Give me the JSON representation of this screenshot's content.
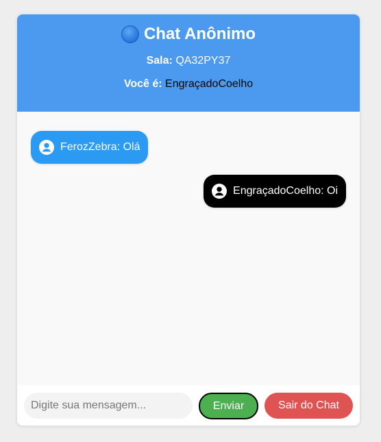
{
  "header": {
    "icon": "blue-circle-icon",
    "title": "Chat Anônimo",
    "room_label": "Sala:",
    "room_code": "QA32PY37",
    "you_label": "Você é:",
    "you_name": "EngraçadoCoelho",
    "color": "#4c9aef"
  },
  "messages": [
    {
      "author": "FerozZebra",
      "text": "FerozZebra: Olá",
      "icon": "user-avatar-icon",
      "color": "#2b9af3",
      "own": false
    },
    {
      "author": "EngraçadoCoelho",
      "text": "EngraçadoCoelho: Oi",
      "icon": "user-avatar-icon",
      "color": "#000000",
      "own": true
    }
  ],
  "composer": {
    "placeholder": "Digite sua mensagem...",
    "value": "",
    "send_label": "Enviar",
    "send_color": "#4caf50",
    "leave_label": "Sair do Chat",
    "leave_color": "#e05353"
  }
}
